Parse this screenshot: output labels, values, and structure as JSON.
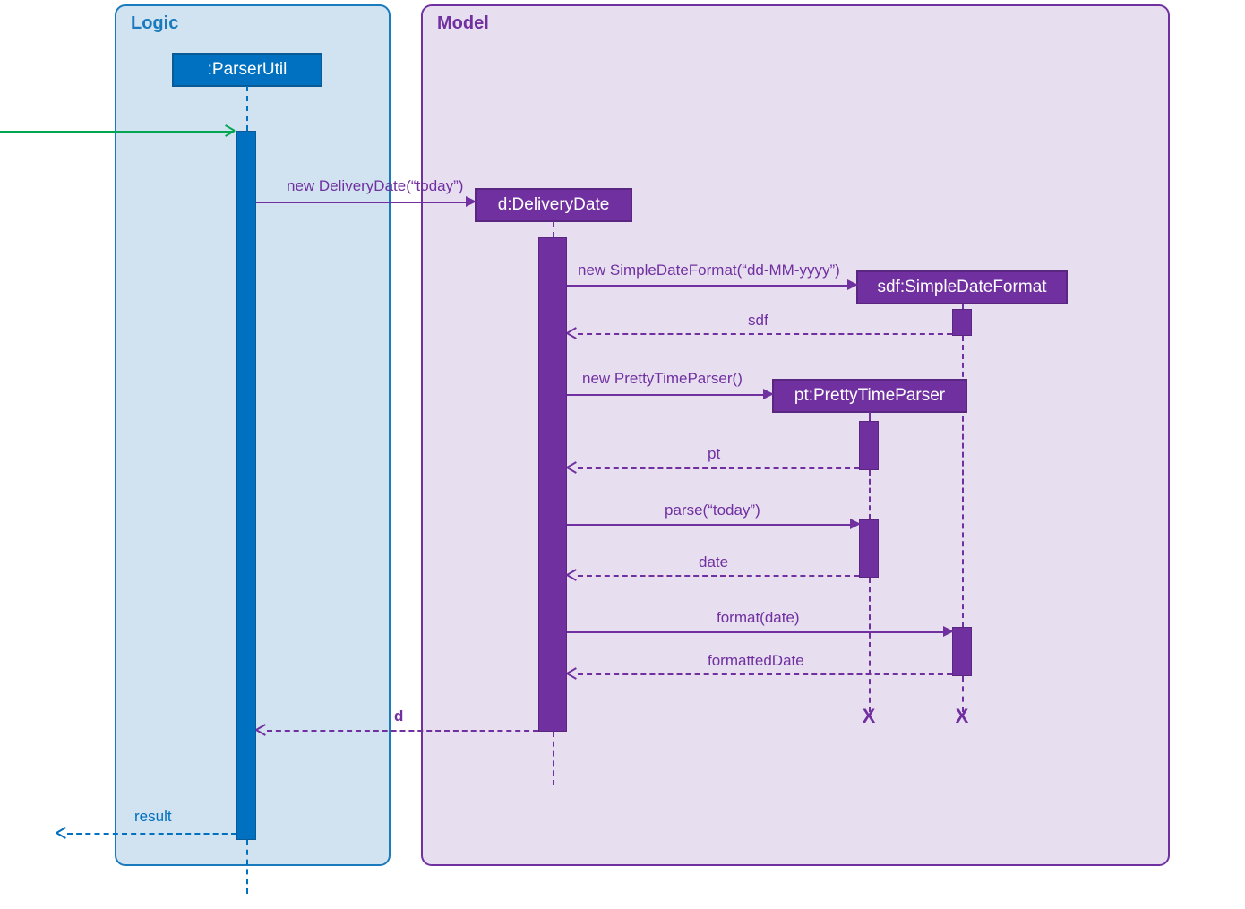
{
  "frames": {
    "logic": {
      "label": "Logic"
    },
    "model": {
      "label": "Model"
    }
  },
  "participants": {
    "parserUtil": ":ParserUtil",
    "deliveryDate": "d:DeliveryDate",
    "sdf": "sdf:SimpleDateFormat",
    "pt": "pt:PrettyTimeParser"
  },
  "messages": {
    "m1": "new DeliveryDate(“today”)",
    "m2": "new SimpleDateFormat(“dd-MM-yyyy”)",
    "r2": "sdf",
    "m3": "new PrettyTimeParser()",
    "r3": "pt",
    "m4": "parse(“today”)",
    "r4": "date",
    "m5": "format(date)",
    "r5": "formattedDate",
    "r_d": "d",
    "r_result": "result"
  },
  "chart_data": {
    "type": "sequence_diagram",
    "frames": [
      {
        "name": "Logic",
        "participants": [
          ":ParserUtil"
        ]
      },
      {
        "name": "Model",
        "participants": [
          "d:DeliveryDate",
          "sdf:SimpleDateFormat",
          "pt:PrettyTimeParser"
        ]
      }
    ],
    "participants": [
      ":ParserUtil",
      "d:DeliveryDate",
      "sdf:SimpleDateFormat",
      "pt:PrettyTimeParser"
    ],
    "interactions": [
      {
        "from": "external",
        "to": ":ParserUtil",
        "label": "",
        "type": "call"
      },
      {
        "from": ":ParserUtil",
        "to": "d:DeliveryDate",
        "label": "new DeliveryDate(\"today\")",
        "type": "create"
      },
      {
        "from": "d:DeliveryDate",
        "to": "sdf:SimpleDateFormat",
        "label": "new SimpleDateFormat(\"dd-MM-yyyy\")",
        "type": "create"
      },
      {
        "from": "sdf:SimpleDateFormat",
        "to": "d:DeliveryDate",
        "label": "sdf",
        "type": "return"
      },
      {
        "from": "d:DeliveryDate",
        "to": "pt:PrettyTimeParser",
        "label": "new PrettyTimeParser()",
        "type": "create"
      },
      {
        "from": "pt:PrettyTimeParser",
        "to": "d:DeliveryDate",
        "label": "pt",
        "type": "return"
      },
      {
        "from": "d:DeliveryDate",
        "to": "pt:PrettyTimeParser",
        "label": "parse(\"today\")",
        "type": "call"
      },
      {
        "from": "pt:PrettyTimeParser",
        "to": "d:DeliveryDate",
        "label": "date",
        "type": "return"
      },
      {
        "from": "d:DeliveryDate",
        "to": "sdf:SimpleDateFormat",
        "label": "format(date)",
        "type": "call"
      },
      {
        "from": "sdf:SimpleDateFormat",
        "to": "d:DeliveryDate",
        "label": "formattedDate",
        "type": "return"
      },
      {
        "from": "d:DeliveryDate",
        "to": ":ParserUtil",
        "label": "d",
        "type": "return"
      },
      {
        "from": ":ParserUtil",
        "to": "external",
        "label": "result",
        "type": "return"
      }
    ],
    "destroyed": [
      "pt:PrettyTimeParser",
      "sdf:SimpleDateFormat"
    ]
  }
}
